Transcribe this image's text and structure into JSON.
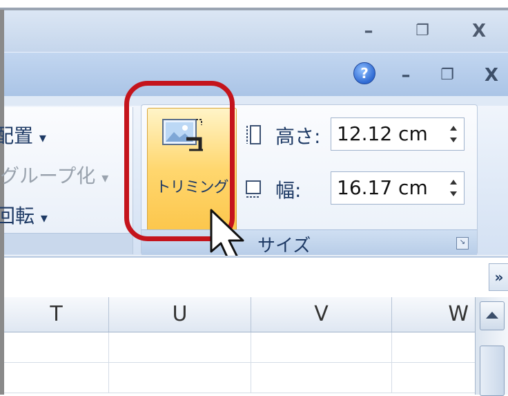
{
  "window": {
    "minimize_glyph": "–",
    "restore_glyph": "❐",
    "close_glyph": "X"
  },
  "docbar": {
    "help_glyph": "?",
    "minimize_glyph": "–",
    "restore_glyph": "❐",
    "close_glyph": "X"
  },
  "ribbon": {
    "arrange": {
      "items": [
        "配置",
        "グループ化",
        "回転"
      ],
      "dropdown_glyph": "▾"
    },
    "size": {
      "group_label": "サイズ",
      "trim_label": "トリミング",
      "height_label": "高さ:",
      "height_value": "12.12 cm",
      "width_label": "幅:",
      "width_value": "16.17 cm",
      "launcher_glyph": "↘"
    }
  },
  "formula_bar": {
    "expand_glyph": "»"
  },
  "columns": [
    "T",
    "U",
    "V",
    "W"
  ],
  "icons": {
    "trim": "crop-icon",
    "height": "height-icon",
    "width": "width-icon",
    "cursor": "mouse-pointer-icon"
  },
  "colors": {
    "highlight": "#c4141c",
    "trim_button": "#fbc345",
    "ribbon": "#dfe9f6"
  }
}
